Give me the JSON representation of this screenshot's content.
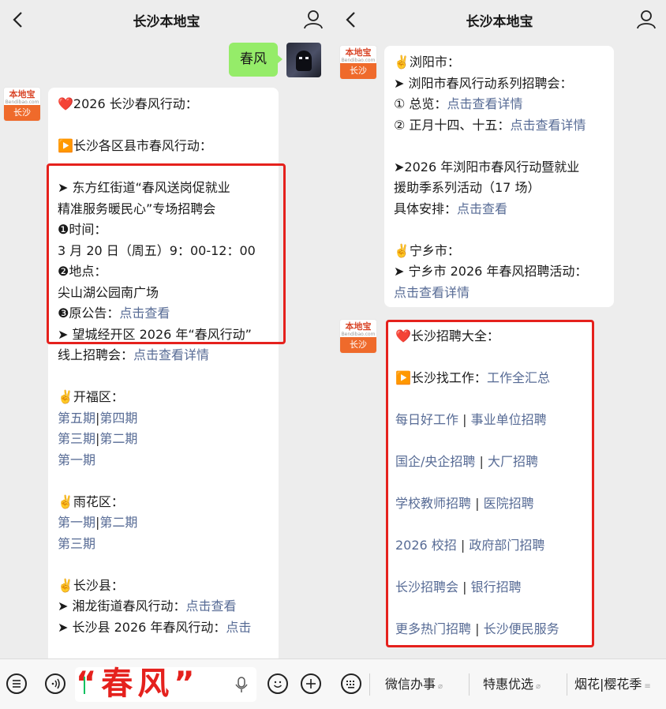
{
  "header": {
    "title": "长沙本地宝"
  },
  "avatar": {
    "brand": "本地宝",
    "domain": "Bendibao.com",
    "city": "长沙"
  },
  "left": {
    "user_message": "春风",
    "lines": [
      {
        "segs": [
          {
            "t": "❤️2026 长沙春风行动："
          }
        ]
      },
      {
        "segs": []
      },
      {
        "segs": [
          {
            "t": "▶️长沙各区县市春风行动："
          }
        ]
      },
      {
        "segs": []
      },
      {
        "segs": [
          {
            "t": "➤ 东方红街道“春风送岗促就业"
          }
        ]
      },
      {
        "segs": [
          {
            "t": "精准服务暖民心”专场招聘会"
          }
        ]
      },
      {
        "segs": [
          {
            "t": "❶时间："
          }
        ]
      },
      {
        "segs": [
          {
            "t": "3 月 20 日（周五）9：00-12：00"
          }
        ]
      },
      {
        "segs": [
          {
            "t": "❷地点："
          }
        ]
      },
      {
        "segs": [
          {
            "t": "尖山湖公园南广场"
          }
        ]
      },
      {
        "segs": [
          {
            "t": "❸原公告："
          },
          {
            "t": "点击查看",
            "link": true
          }
        ]
      },
      {
        "segs": [
          {
            "t": "➤ 望城经开区 2026 年“春风行动”"
          }
        ]
      },
      {
        "segs": [
          {
            "t": "线上招聘会："
          },
          {
            "t": "点击查看详情",
            "link": true
          }
        ]
      },
      {
        "segs": []
      },
      {
        "segs": [
          {
            "t": "✌️开福区："
          }
        ]
      },
      {
        "segs": [
          {
            "t": "第五期",
            "link": true
          },
          {
            "t": "|",
            "sep": true
          },
          {
            "t": "第四期",
            "link": true
          }
        ]
      },
      {
        "segs": [
          {
            "t": "第三期",
            "link": true
          },
          {
            "t": "|",
            "sep": true
          },
          {
            "t": "第二期",
            "link": true
          }
        ]
      },
      {
        "segs": [
          {
            "t": "第一期",
            "link": true
          }
        ]
      },
      {
        "segs": []
      },
      {
        "segs": [
          {
            "t": "✌️雨花区："
          }
        ]
      },
      {
        "segs": [
          {
            "t": "第一期",
            "link": true
          },
          {
            "t": "|",
            "sep": true
          },
          {
            "t": "第二期",
            "link": true
          }
        ]
      },
      {
        "segs": [
          {
            "t": "第三期",
            "link": true
          }
        ]
      },
      {
        "segs": []
      },
      {
        "segs": [
          {
            "t": "✌️长沙县："
          }
        ]
      },
      {
        "segs": [
          {
            "t": "➤ 湘龙街道春风行动："
          },
          {
            "t": "点击查看",
            "link": true
          }
        ]
      },
      {
        "segs": [
          {
            "t": "➤ 长沙县 2026 年春风行动："
          },
          {
            "t": "点击",
            "link": true
          }
        ]
      }
    ],
    "input_text": "“春风”"
  },
  "right": {
    "bubble1_lines": [
      {
        "segs": [
          {
            "t": "✌️浏阳市："
          }
        ]
      },
      {
        "segs": [
          {
            "t": "➤ 浏阳市春风行动系列招聘会："
          }
        ]
      },
      {
        "segs": [
          {
            "t": "① 总览："
          },
          {
            "t": "点击查看详情",
            "link": true
          }
        ]
      },
      {
        "segs": [
          {
            "t": "② 正月十四、十五："
          },
          {
            "t": "点击查看详情",
            "link": true
          }
        ]
      },
      {
        "segs": []
      },
      {
        "segs": [
          {
            "t": "➤2026 年浏阳市春风行动暨就业"
          }
        ]
      },
      {
        "segs": [
          {
            "t": "援助季系列活动（17 场）"
          }
        ]
      },
      {
        "segs": [
          {
            "t": "具体安排："
          },
          {
            "t": "点击查看",
            "link": true
          }
        ]
      },
      {
        "segs": []
      },
      {
        "segs": [
          {
            "t": "✌️宁乡市："
          }
        ]
      },
      {
        "segs": [
          {
            "t": "➤ 宁乡市 2026 年春风招聘活动："
          }
        ]
      },
      {
        "segs": [
          {
            "t": "点击查看详情",
            "link": true
          }
        ]
      }
    ],
    "bubble2_lines": [
      {
        "segs": [
          {
            "t": "❤️长沙招聘大全："
          }
        ]
      },
      {
        "segs": []
      },
      {
        "segs": [
          {
            "t": "▶️长沙找工作："
          },
          {
            "t": "工作全汇总",
            "link": true
          }
        ]
      },
      {
        "segs": []
      },
      {
        "segs": [
          {
            "t": "每日好工作",
            "link": true
          },
          {
            "t": " | ",
            "sep": true
          },
          {
            "t": "事业单位招聘",
            "link": true
          }
        ]
      },
      {
        "segs": []
      },
      {
        "segs": [
          {
            "t": "国企/央企招聘",
            "link": true
          },
          {
            "t": " | ",
            "sep": true
          },
          {
            "t": "大厂招聘",
            "link": true
          }
        ]
      },
      {
        "segs": []
      },
      {
        "segs": [
          {
            "t": "学校教师招聘",
            "link": true
          },
          {
            "t": " | ",
            "sep": true
          },
          {
            "t": "医院招聘",
            "link": true
          }
        ]
      },
      {
        "segs": []
      },
      {
        "segs": [
          {
            "t": "2026 校招",
            "link": true
          },
          {
            "t": " | ",
            "sep": true
          },
          {
            "t": "政府部门招聘",
            "link": true
          }
        ]
      },
      {
        "segs": []
      },
      {
        "segs": [
          {
            "t": "长沙招聘会",
            "link": true
          },
          {
            "t": " | ",
            "sep": true
          },
          {
            "t": "银行招聘",
            "link": true
          }
        ]
      },
      {
        "segs": []
      },
      {
        "segs": [
          {
            "t": "更多热门招聘",
            "link": true
          },
          {
            "t": " | ",
            "sep": true
          },
          {
            "t": "长沙便民服务",
            "link": true
          }
        ]
      }
    ],
    "menu": [
      "微信办事",
      "特惠优选",
      "烟花|樱花季"
    ]
  },
  "icons": {
    "back": "chevron-left-icon",
    "user": "user-profile-icon",
    "list": "list-menu-icon",
    "voice": "voice-icon",
    "mic": "microphone-icon",
    "emoji": "emoji-icon",
    "add": "add-circle-icon",
    "keyboard": "keyboard-icon",
    "link": "link-icon"
  },
  "colors": {
    "link": "#576b95",
    "highlight": "#e5211d",
    "user_bubble": "#95ec69",
    "brand": "#ef6a2b"
  }
}
